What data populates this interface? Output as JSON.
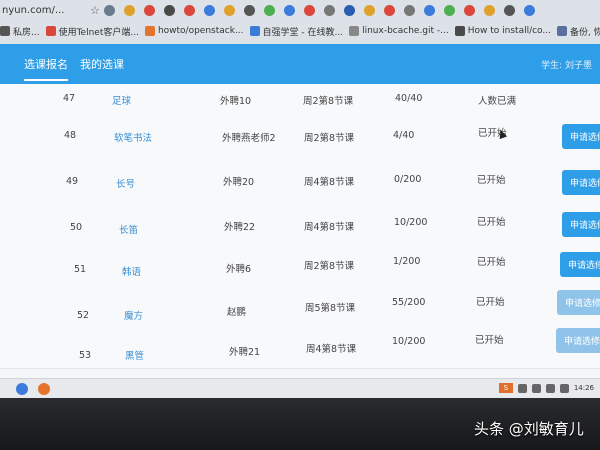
{
  "browser": {
    "address_text": "nyun.com/...",
    "bookmarks": [
      {
        "label": "私房...",
        "icon": "bookmark-icon"
      },
      {
        "label": "使用Telnet客户端...",
        "icon": "telnet-icon"
      },
      {
        "label": "howto/openstack...",
        "icon": "gitlab-icon"
      },
      {
        "label": "自强学堂 - 在线教...",
        "icon": "page-icon"
      },
      {
        "label": "linux-bcache.git -...",
        "icon": "page-icon"
      },
      {
        "label": "How to install/co...",
        "icon": "page-icon"
      },
      {
        "label": "备份, 恢复, 迁移...",
        "icon": "page-icon"
      }
    ]
  },
  "nav": {
    "tabs": [
      "选课报名",
      "我的选课"
    ],
    "student_label": "学生: 刘子墨"
  },
  "rows": [
    {
      "id": "47",
      "course": "足球",
      "teacher": "外聘10",
      "time": "周2第8节课",
      "enrolled": "40/40",
      "status": "人数已满",
      "action": ""
    },
    {
      "id": "48",
      "course": "软笔书法",
      "teacher": "外聘燕老师2",
      "time": "周2第8节课",
      "enrolled": "4/40",
      "status": "已开始",
      "action": "申请选修"
    },
    {
      "id": "49",
      "course": "长号",
      "teacher": "外聘20",
      "time": "周4第8节课",
      "enrolled": "0/200",
      "status": "已开始",
      "action": "申请选修"
    },
    {
      "id": "50",
      "course": "长笛",
      "teacher": "外聘22",
      "time": "周4第8节课",
      "enrolled": "10/200",
      "status": "已开始",
      "action": "申请选修"
    },
    {
      "id": "51",
      "course": "韩语",
      "teacher": "外聘6",
      "time": "周2第8节课",
      "enrolled": "1/200",
      "status": "已开始",
      "action": "申请选修"
    },
    {
      "id": "52",
      "course": "魔方",
      "teacher": "赵鹏",
      "time": "周5第8节课",
      "enrolled": "55/200",
      "status": "已开始",
      "action": "申请选修"
    },
    {
      "id": "53",
      "course": "黑管",
      "teacher": "外聘21",
      "time": "周4第8节课",
      "enrolled": "10/200",
      "status": "已开始",
      "action": "申请选修"
    }
  ],
  "taskbar": {
    "ime_label": "S",
    "time_text": "14:26"
  },
  "watermark": "头条 @刘敏育儿"
}
